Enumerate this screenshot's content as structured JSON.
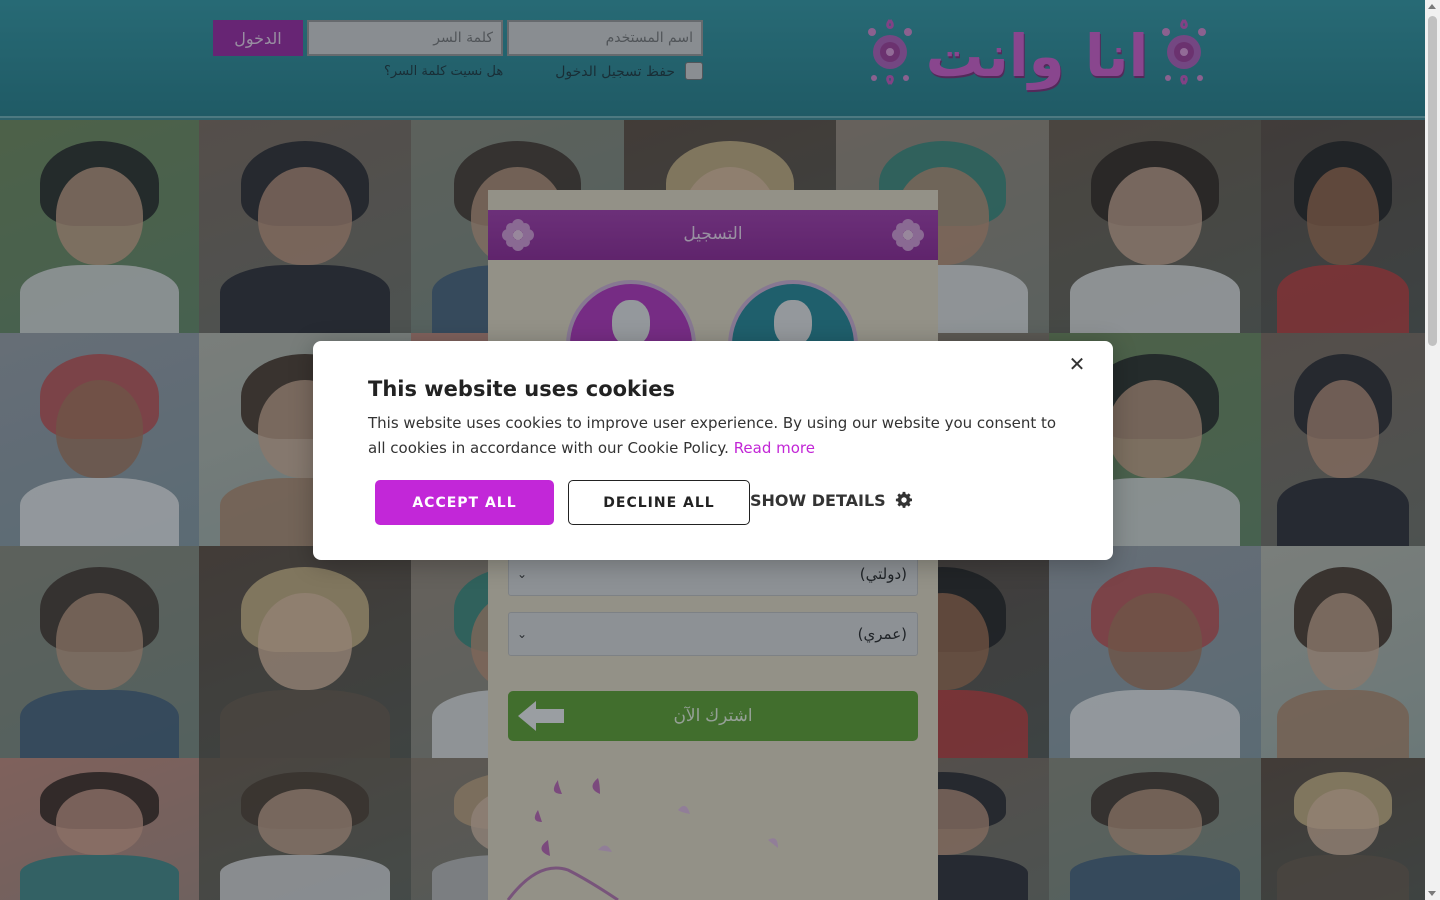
{
  "header": {
    "logo_text": "انا وانت",
    "username_placeholder": "اسم المستخدم",
    "password_placeholder": "كلمة السر",
    "login_label": "الدخول",
    "remember_label": "حفظ تسجيل الدخول",
    "forgot_label": "هل نسيت كلمة السر؟"
  },
  "register": {
    "title": "التسجيل",
    "country_placeholder": "(دولتي)",
    "age_placeholder": "(عمري)",
    "subscribe_label": "اشترك الآن"
  },
  "cookie_dialog": {
    "title": "This website uses cookies",
    "text": "This website uses cookies to improve user experience. By using our website you consent to all cookies in accordance with our Cookie Policy.",
    "read_more": "Read more",
    "accept_label": "ACCEPT ALL",
    "decline_label": "DECLINE ALL",
    "details_label": "SHOW DETAILS"
  },
  "colors": {
    "header_teal": "#217f8b",
    "brand_purple": "#9b24a4",
    "accept_magenta": "#c227d8",
    "subscribe_green": "#5aa02a",
    "panel_beige": "#e7ddc4"
  },
  "icons": {
    "close": "close-icon",
    "gear": "gear-icon",
    "arrow": "arrow-left-icon",
    "chevron": "chevron-down-icon"
  }
}
